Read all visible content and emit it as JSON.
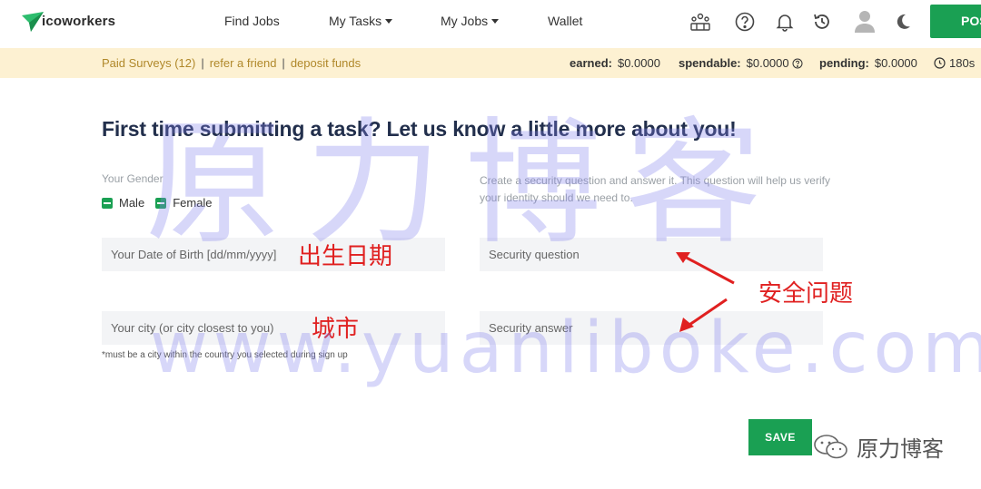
{
  "app": {
    "brand": "icoworkers"
  },
  "nav": {
    "find_jobs": "Find Jobs",
    "my_tasks": "My Tasks",
    "my_jobs": "My Jobs",
    "wallet": "Wallet",
    "post_label": "POS"
  },
  "icons": {
    "team": "team-icon",
    "help": "help-circle-icon",
    "bell": "bell-icon",
    "history": "history-icon",
    "avatar": "avatar-icon",
    "theme": "moon-icon"
  },
  "subbar": {
    "paid_surveys": "Paid Surveys (12)",
    "refer": "refer a friend",
    "deposit": "deposit funds",
    "separator": "|",
    "earned_label": "earned:",
    "earned_value": "$0.0000",
    "spendable_label": "spendable:",
    "spendable_value": "$0.0000",
    "pending_label": "pending:",
    "pending_value": "$0.0000",
    "timer": "180s"
  },
  "form": {
    "title": "First time submitting a task? Let us know a little more about you!",
    "gender_label": "Your Gender",
    "male": "Male",
    "female": "Female",
    "security_desc": "Create a security question and answer it. This question will help us verify your identity should we need to.",
    "dob_placeholder": "Your Date of Birth [dd/mm/yyyy]",
    "security_question_placeholder": "Security question",
    "city_placeholder": "Your city (or city closest to you)",
    "security_answer_placeholder": "Security answer",
    "city_hint": "*must be a city within the country you selected during sign up",
    "save": "SAVE"
  },
  "annotations": {
    "dob": "出生日期",
    "city": "城市",
    "security": "安全问题"
  },
  "watermark": {
    "big": "原力博客",
    "url": "www.yuanliboke.com",
    "badge": "原力博客"
  },
  "colors": {
    "brand_green": "#1aa053",
    "subbar_bg": "#fdf1d2",
    "link_gold": "#b0882a",
    "title_navy": "#222f4c",
    "annotation_red": "#e02020"
  }
}
